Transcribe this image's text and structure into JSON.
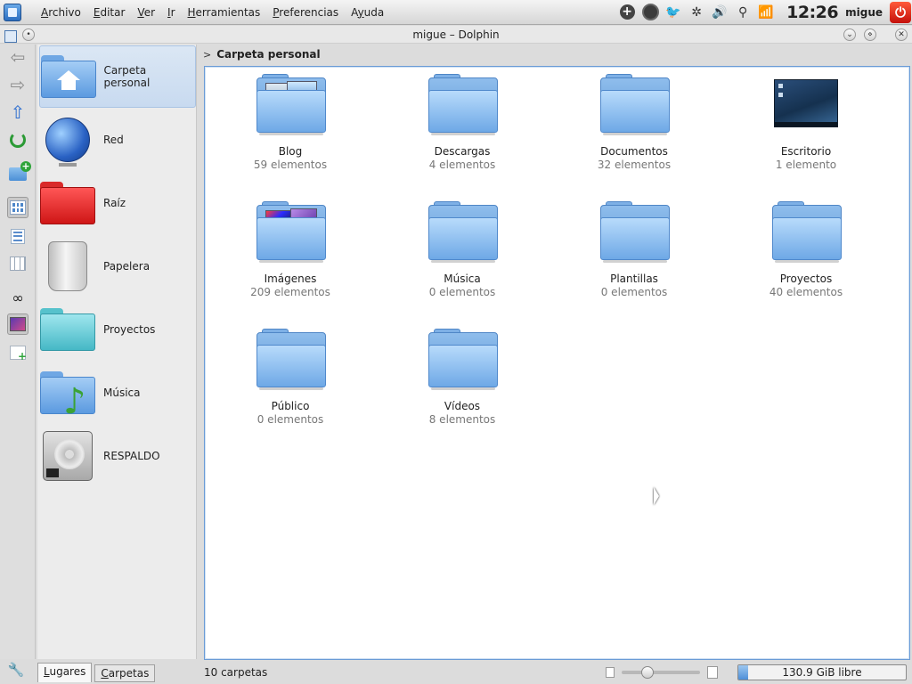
{
  "window": {
    "title": "migue – Dolphin"
  },
  "menu": [
    {
      "label": "Archivo",
      "key": "A"
    },
    {
      "label": "Editar",
      "key": "E"
    },
    {
      "label": "Ver",
      "key": "V"
    },
    {
      "label": "Ir",
      "key": "I"
    },
    {
      "label": "Herramientas",
      "key": "H"
    },
    {
      "label": "Preferencias",
      "key": "P"
    },
    {
      "label": "Ayuda",
      "key": "y"
    }
  ],
  "tray": {
    "icons": [
      "add-widget-icon",
      "activity-icon",
      "twitter-icon",
      "network-cluster-icon",
      "volume-icon",
      "usb-icon",
      "wifi-icon"
    ],
    "clock": "12:26",
    "user": "migue",
    "power_icon": "power-icon"
  },
  "places": [
    {
      "label": "Carpeta personal",
      "icon": "home-folder-icon",
      "active": true
    },
    {
      "label": "Red",
      "icon": "network-globe-icon"
    },
    {
      "label": "Raíz",
      "icon": "red-folder-icon"
    },
    {
      "label": "Papelera",
      "icon": "trash-icon"
    },
    {
      "label": "Proyectos",
      "icon": "cyan-folder-icon"
    },
    {
      "label": "Música",
      "icon": "music-folder-icon"
    },
    {
      "label": "RESPALDO",
      "icon": "hard-drive-icon"
    }
  ],
  "panel_tabs": [
    {
      "label": "Lugares",
      "key": "L",
      "active": true
    },
    {
      "label": "Carpetas",
      "key": "C"
    }
  ],
  "breadcrumb": {
    "arrow": ">",
    "label": "Carpeta personal"
  },
  "items": [
    {
      "name": "Blog",
      "count": "59 elementos",
      "icon": "folder-thumbs-icon"
    },
    {
      "name": "Descargas",
      "count": "4 elementos",
      "icon": "folder-icon"
    },
    {
      "name": "Documentos",
      "count": "32 elementos",
      "icon": "folder-icon"
    },
    {
      "name": "Escritorio",
      "count": "1 elemento",
      "icon": "desktop-icon"
    },
    {
      "name": "Imágenes",
      "count": "209 elementos",
      "icon": "folder-images-icon"
    },
    {
      "name": "Música",
      "count": "0 elementos",
      "icon": "folder-icon"
    },
    {
      "name": "Plantillas",
      "count": "0 elementos",
      "icon": "folder-icon"
    },
    {
      "name": "Proyectos",
      "count": "40 elementos",
      "icon": "folder-icon"
    },
    {
      "name": "Público",
      "count": "0 elementos",
      "icon": "folder-icon"
    },
    {
      "name": "Vídeos",
      "count": "8 elementos",
      "icon": "folder-icon"
    }
  ],
  "status": {
    "count": "10 carpetas",
    "zoom_fraction": 0.33,
    "free_space": "130.9 GiB libre",
    "used_fraction": 0.06
  },
  "colors": {
    "accent": "#6a9bd6",
    "folder_blue": "#6ea8e6",
    "places_active": "#c8daf0"
  }
}
